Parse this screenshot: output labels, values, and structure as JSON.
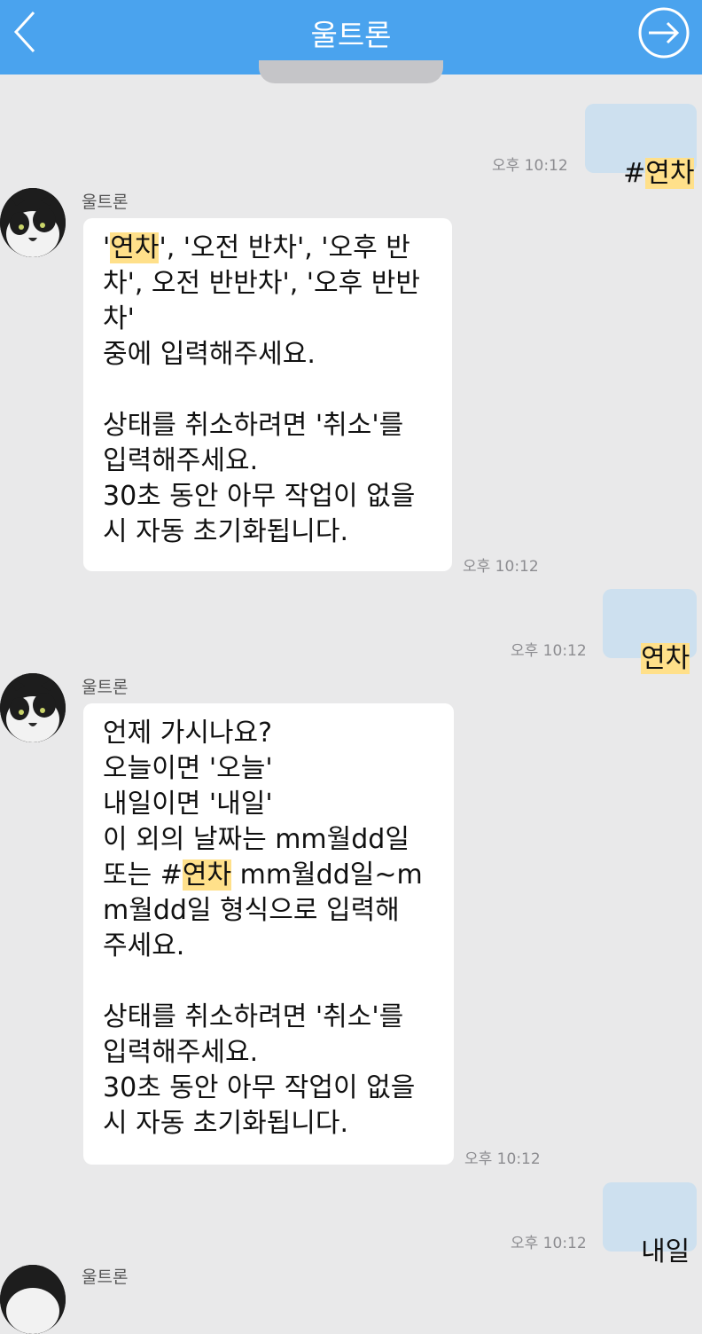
{
  "header": {
    "title": "울트론",
    "back_icon": "chevron-left-icon",
    "forward_icon": "arrow-right-circle-icon"
  },
  "colors": {
    "header_bg": "#4aa3ee",
    "chat_bg": "#e9e9ea",
    "outgoing_bubble": "#cde0ef",
    "incoming_bubble": "#ffffff",
    "highlight": "#ffe08a",
    "time_text": "#8c8c90"
  },
  "messages": [
    {
      "direction": "out",
      "parts": [
        {
          "text": "#",
          "hl": false
        },
        {
          "text": "연차",
          "hl": true
        }
      ],
      "time": "오후 10:12"
    },
    {
      "direction": "in",
      "sender": "울트론",
      "parts": [
        {
          "text": "'",
          "hl": false
        },
        {
          "text": "연차",
          "hl": true
        },
        {
          "text": "', '오전 반차', '오후 반\n차', 오전 반반차', '오후 반반\n차'\n중에 입력해주세요.\n\n상태를 취소하려면 '취소'를\n입력해주세요.\n30초 동안 아무 작업이 없을\n시 자동 초기화됩니다.",
          "hl": false
        }
      ],
      "time": "오후 10:12"
    },
    {
      "direction": "out",
      "parts": [
        {
          "text": "연차",
          "hl": true
        }
      ],
      "time": "오후 10:12"
    },
    {
      "direction": "in",
      "sender": "울트론",
      "parts": [
        {
          "text": "언제 가시나요?\n오늘이면 '오늘'\n내일이면 '내일'\n이 외의 날짜는 mm월dd일\n또는 #",
          "hl": false
        },
        {
          "text": "연차",
          "hl": true
        },
        {
          "text": " mm월dd일~m\nm월dd일 형식으로 입력해\n주세요.\n\n상태를 취소하려면 '취소'를\n입력해주세요.\n30초 동안 아무 작업이 없을\n시 자동 초기화됩니다.",
          "hl": false
        }
      ],
      "time": "오후 10:12"
    },
    {
      "direction": "out",
      "parts": [
        {
          "text": "내일",
          "hl": false
        }
      ],
      "time": "오후 10:12"
    },
    {
      "direction": "in",
      "sender": "울트론",
      "parts": [],
      "time": ""
    }
  ]
}
